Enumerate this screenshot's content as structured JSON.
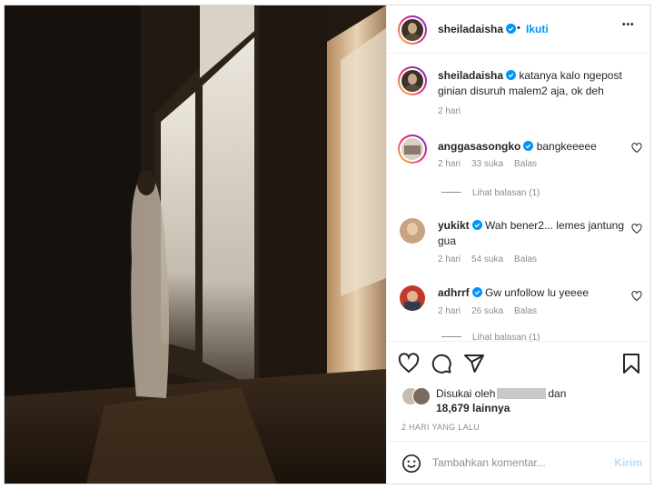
{
  "header": {
    "username": "sheiladaisha",
    "separator": "•",
    "follow_label": "Ikuti",
    "more_label": "•••"
  },
  "caption": {
    "username": "sheiladaisha",
    "text": "katanya kalo ngepost ginian disuruh malem2 aja, ok deh",
    "time": "2 hari"
  },
  "comments": [
    {
      "username": "anggasasongko",
      "text": "bangkeeeee",
      "time": "2 hari",
      "likes": "33 suka",
      "reply": "Balas",
      "view_replies": "Lihat balasan (1)"
    },
    {
      "username": "yukikt",
      "text": "Wah bener2... lemes jantung gua",
      "time": "2 hari",
      "likes": "54 suka",
      "reply": "Balas"
    },
    {
      "username": "adhrrf",
      "text": "Gw unfollow lu yeeee",
      "time": "2 hari",
      "likes": "26 suka",
      "reply": "Balas",
      "view_replies": "Lihat balasan (1)"
    }
  ],
  "likes": {
    "prefix": "Disukai oleh",
    "suffix": "dan",
    "count": "18,679 lainnya"
  },
  "post_date": "2 HARI YANG LALU",
  "add_comment": {
    "placeholder": "Tambahkan komentar...",
    "post_label": "Kirim"
  },
  "icons": {
    "verified": "verified-badge-icon",
    "like": "heart-icon",
    "comment": "comment-icon",
    "share": "share-icon",
    "save": "bookmark-icon",
    "emoji": "emoji-icon",
    "more": "more-icon"
  },
  "colors": {
    "accent": "#0095f6",
    "muted": "#8e8e8e",
    "text": "#262626"
  }
}
